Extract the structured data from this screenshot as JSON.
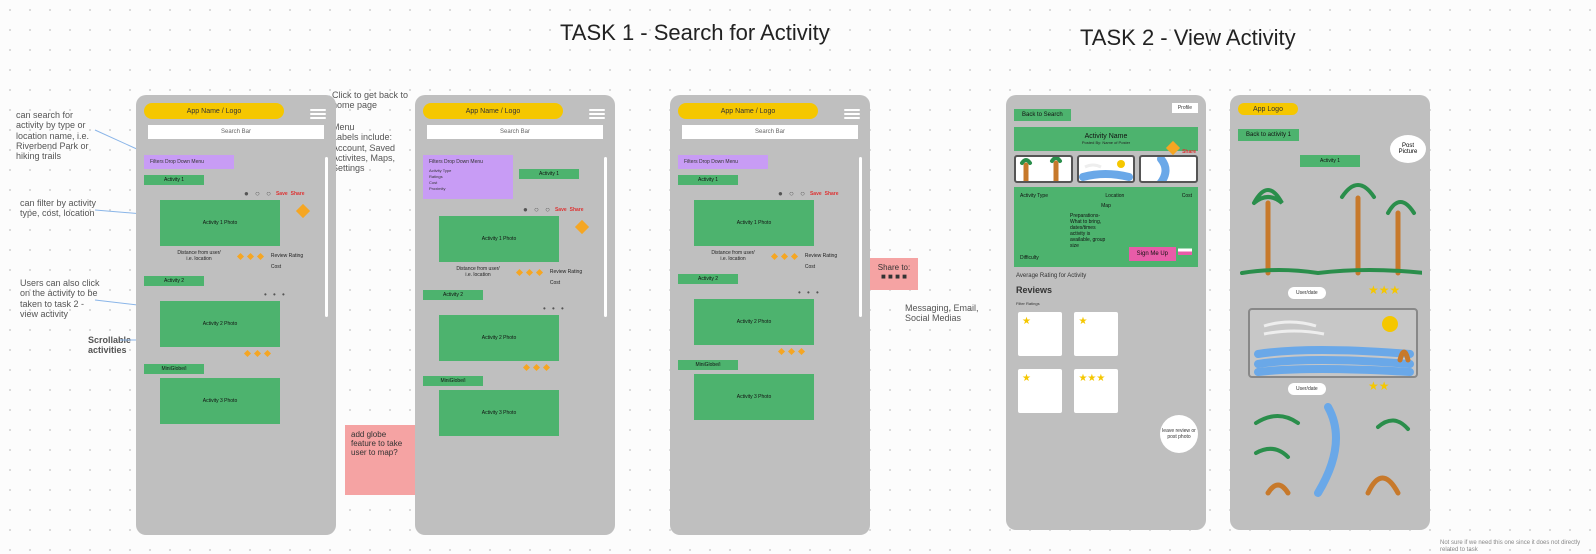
{
  "titles": {
    "task1": "TASK 1 - Search for Activity",
    "task2": "TASK 2 - View Activity"
  },
  "annotations": {
    "search_by": "can search for activity by type or location name, i.e. Riverbend Park or hiking trails",
    "filter_by": "can filter by activity type, cost, location",
    "click_activity": "Users can also click on the activity to be taken to task 2 - view activity",
    "scrollable": "Scrollable activities",
    "logo_click": "Click to get back to home page",
    "menu_labels": "Menu\nLabels include: Account, Saved Activites, Maps, Settings",
    "share_via": "Messaging, Email, Social Medias",
    "footer_note": "Not sure if we need this one since it does not directly related to task"
  },
  "stickies": {
    "globe": "add globe feature to take user to map?",
    "shareto": "Share to:\n■ ■ ■ ■"
  },
  "common": {
    "logo": "App Name / Logo",
    "search": "Search Bar",
    "filters": "Filters Drop Down Menu",
    "filter_options": [
      "Activity Type",
      "Ratings",
      "Cost",
      "Proximity"
    ],
    "save": "Save",
    "share": "Share",
    "review_rating": "Review Rating",
    "cost": "Cost",
    "distance": "Distance from user/\ni.e. location",
    "activities": [
      "Activity 1",
      "Activity 1 Photo",
      "Activity 2",
      "Activity 2 Photo",
      "MiniGlobe/i",
      "Activity 3 Photo"
    ]
  },
  "task2_detail": {
    "back": "Back to Search",
    "profile": "Profile",
    "name": "Activity Name",
    "posted": "Posted By: Name of Poster",
    "labels": {
      "type": "Activity Type",
      "loc": "Location",
      "cost": "Cost",
      "diff": "Difficulty",
      "map": "Map"
    },
    "prep": "Preparations-\nWhat to bring,\ndates/times\nactivity is\navailable, group\nsize",
    "signup": "Sign Me Up",
    "avg": "Average Rating for Activity",
    "reviews": "Reviews",
    "filter_ratings": "Filter Ratings",
    "leave": "leave review or post photo"
  },
  "task2_photos": {
    "logo": "App  Logo",
    "back": "Back to activity 1",
    "activity": "Activity 1",
    "post": "Post Picture",
    "userdate": "User/date"
  }
}
